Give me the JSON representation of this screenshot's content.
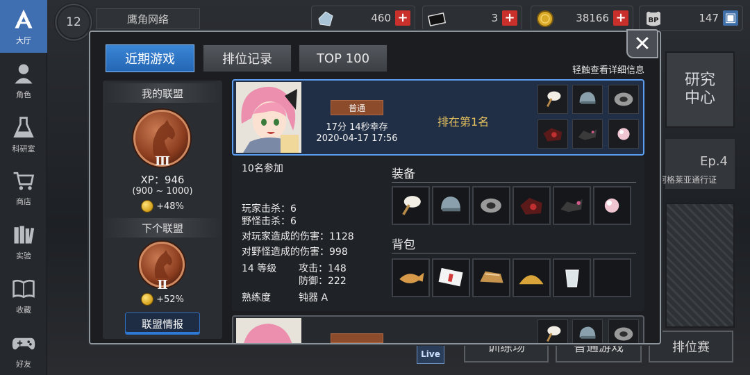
{
  "nav": [
    {
      "label": "大厅",
      "icon": "lobby-icon"
    },
    {
      "label": "角色",
      "icon": "character-icon"
    },
    {
      "label": "科研室",
      "icon": "flask-icon"
    },
    {
      "label": "商店",
      "icon": "cart-icon"
    },
    {
      "label": "实验",
      "icon": "books-icon"
    },
    {
      "label": "收藏",
      "icon": "open-book-icon"
    },
    {
      "label": "好友",
      "icon": "gamepad-icon"
    }
  ],
  "top": {
    "level": "12",
    "player_name": "鹰角网络",
    "resources": [
      {
        "value": "460",
        "icon": "gem-icon"
      },
      {
        "value": "3",
        "icon": "ticket-icon"
      },
      {
        "value": "38166",
        "icon": "coin-icon"
      },
      {
        "value": "147",
        "icon": "bp-icon"
      }
    ]
  },
  "background": {
    "research": "研究\n中心",
    "ep_title": "Ep.4",
    "ep_sub": "阿格莱亚通行证",
    "buttons": [
      "训练场",
      "普通游戏",
      "排位赛"
    ],
    "live": "Live"
  },
  "dialog": {
    "tabs": [
      "近期游戏",
      "排位记录",
      "TOP 100"
    ],
    "hint": "轻触查看详细信息",
    "close": "✕"
  },
  "league": {
    "my_title": "我的联盟",
    "my_roman": "Ⅲ",
    "xp": "XP：946",
    "range": "(900 ~ 1000)",
    "my_bonus": "+48%",
    "next_title": "下个联盟",
    "next_roman": "Ⅱ",
    "next_bonus": "+52%",
    "info_button": "联盟情报"
  },
  "match": {
    "mode": "普通",
    "survive": "17分 14秒幸存",
    "date": "2020-04-17 17:56",
    "rank": "排在第1名",
    "participants": "10名参加",
    "player_kills": "玩家击杀：6",
    "monster_kills": "野怪击杀：6",
    "player_damage": "对玩家造成的伤害：1128",
    "monster_damage": "对野怪造成的伤害：998",
    "level": "14 等级",
    "attack": "攻击：148",
    "defense": "防御：222",
    "proficiency_label": "熟练度",
    "proficiency_value": "钝器 A",
    "equip_title": "装备",
    "bag_title": "背包"
  },
  "colors": {
    "accent": "#2e78d6",
    "rank_text": "#e7c25e",
    "badge": "#8c4b2b",
    "plus_red": "#c9302c"
  }
}
